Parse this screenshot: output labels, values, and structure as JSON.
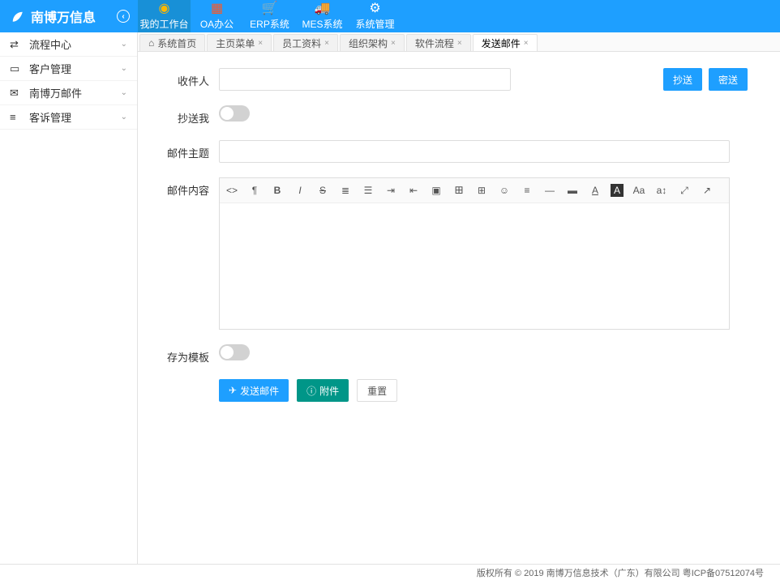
{
  "header": {
    "brand": "南博万信息",
    "nav": [
      {
        "label": "我的工作台",
        "icon": "user-circle",
        "color": "#FFB800"
      },
      {
        "label": "OA办公",
        "icon": "grid",
        "color": "#FF5722"
      },
      {
        "label": "ERP系统",
        "icon": "cart",
        "color": "#2F4056"
      },
      {
        "label": "MES系统",
        "icon": "truck",
        "color": "#FFB800"
      },
      {
        "label": "系统管理",
        "icon": "gears",
        "color": "#fff"
      }
    ]
  },
  "sidebar": {
    "items": [
      {
        "icon": "⇄",
        "label": "流程中心"
      },
      {
        "icon": "▭",
        "label": "客户管理"
      },
      {
        "icon": "✉",
        "label": "南博万邮件"
      },
      {
        "icon": "≡",
        "label": "客诉管理"
      }
    ]
  },
  "tabs": [
    {
      "label": "系统首页",
      "home": true,
      "closable": false
    },
    {
      "label": "主页菜单",
      "closable": true
    },
    {
      "label": "员工资料",
      "closable": true
    },
    {
      "label": "组织架构",
      "closable": true
    },
    {
      "label": "软件流程",
      "closable": true
    },
    {
      "label": "发送邮件",
      "closable": true,
      "active": true
    }
  ],
  "form": {
    "recipient_label": "收件人",
    "cc_btn": "抄送",
    "bcc_btn": "密送",
    "cc_me_label": "抄送我",
    "subject_label": "邮件主题",
    "content_label": "邮件内容",
    "save_template_label": "存为模板",
    "send_btn": "发送邮件",
    "attach_btn": "附件",
    "reset_btn": "重置"
  },
  "editor_tools": [
    "code",
    "pilcrow",
    "bold",
    "italic",
    "strike",
    "ol",
    "ul",
    "indent",
    "outdent",
    "image",
    "link",
    "table",
    "emoji",
    "align",
    "hr",
    "bg",
    "fontcolor",
    "bgcolor",
    "fontsize",
    "lineheight",
    "fullscreen",
    "preview"
  ],
  "footer": {
    "text": "版权所有 © 2019 南博万信息技术（广东）有限公司  粤ICP备07512074号"
  }
}
